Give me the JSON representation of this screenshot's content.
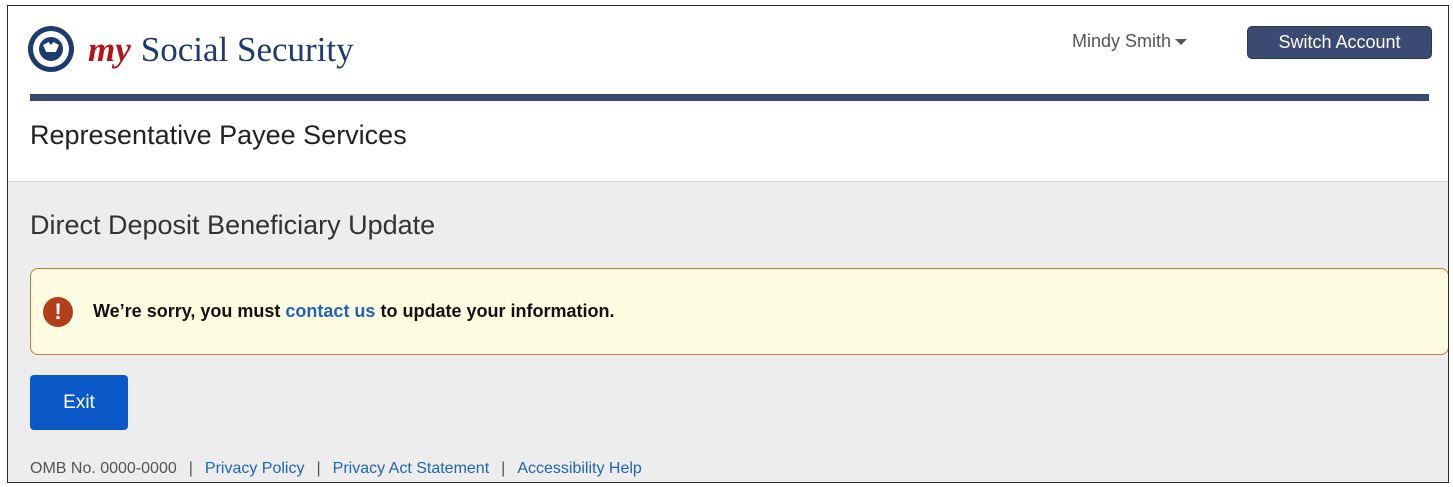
{
  "header": {
    "brand_my": "my",
    "brand_rest": "Social Security",
    "user_name": "Mindy Smith",
    "switch_account_label": "Switch Account"
  },
  "service_title": "Representative Payee Services",
  "page_title": "Direct Deposit Beneficiary Update",
  "alert": {
    "icon": "exclamation-icon",
    "icon_glyph": "!",
    "text_before": "We’re sorry, you must",
    "link_text": "contact us",
    "text_after": "to update your information."
  },
  "exit_label": "Exit",
  "footer": {
    "omb": "OMB No. 0000-0000",
    "separator": "|",
    "links": [
      "Privacy Policy",
      "Privacy Act Statement",
      "Accessibility Help"
    ]
  },
  "colors": {
    "brand_navy": "#3b4a73",
    "brand_red": "#b5121b",
    "primary_button": "#0b58c8",
    "alert_background": "#fefde2",
    "alert_border": "#c67a37",
    "link": "#1f64b7"
  }
}
